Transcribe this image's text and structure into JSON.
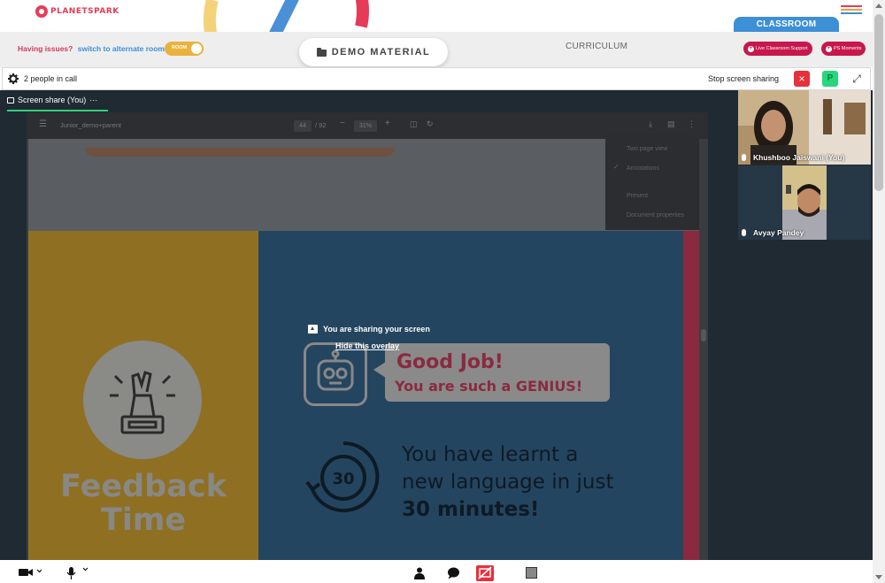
{
  "header": {
    "logo_text": "PLANETSPARK",
    "classroom_tab": "CLASSROOM"
  },
  "subbar": {
    "issues_text": "Having issues?",
    "switch_text": "switch to alternate room",
    "toggle_label": "ROOM",
    "demo_material": "DEMO MATERIAL",
    "curriculum": "CURRICULUM",
    "live_support": "Live Classroom Support",
    "ps_moments": "PS Moments"
  },
  "call": {
    "people_count": "2 people in call",
    "stop_sharing": "Stop screen sharing",
    "stop_icon": "×",
    "participant_badge": "P",
    "expand_icon": "⤢"
  },
  "stage": {
    "tab_label": "Screen share (You)",
    "tab_more": "···"
  },
  "pdf": {
    "file_name": "Junior_demo+parent",
    "page_current": "44",
    "page_total": "/ 92",
    "zoom": "31%",
    "menu_items": [
      "Two page view",
      "Annotations",
      "Present",
      "Document properties"
    ]
  },
  "slide": {
    "feedback_line1": "Feedback",
    "feedback_line2": "Time",
    "good_job": "Good Job!",
    "genius": "You are such a GENIUS!",
    "clock_value": "30",
    "learnt_line1": "You have learnt a",
    "learnt_line2": "new language in just",
    "learnt_line3": "30 minutes!"
  },
  "overlay": {
    "title": "You are sharing your screen",
    "hide_link": "Hide this overlay"
  },
  "participants": [
    {
      "name": "Khushboo Jaiswani (You)"
    },
    {
      "name": "Avyay Pandey"
    }
  ],
  "colors": {
    "brand_red": "#e63b58",
    "brand_blue": "#3d8fd6",
    "stop_red": "#e8303c",
    "badge_green": "#27d67f",
    "stage_dark": "#1f2a33"
  }
}
